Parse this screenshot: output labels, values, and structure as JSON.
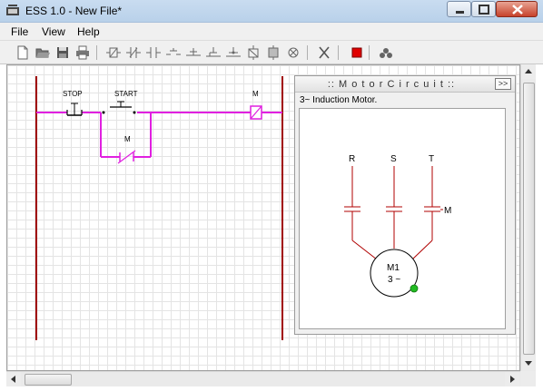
{
  "window": {
    "title": "ESS 1.0 - New File*",
    "controls": {
      "minimize": "minimize",
      "maximize": "maximize",
      "close": "close"
    }
  },
  "menu": {
    "items": [
      {
        "label": "File"
      },
      {
        "label": "View"
      },
      {
        "label": "Help"
      }
    ]
  },
  "toolbar": {
    "buttons": [
      "new-file-icon",
      "open-folder-icon",
      "save-icon",
      "print-icon",
      "coil-tool-icon",
      "contact-no-icon",
      "contact-nc-icon",
      "contact-no-alt-icon",
      "branch-tool-icon",
      "wire-tool-icon",
      "junction-tool-icon",
      "timer-tool-icon",
      "relay-tool-icon",
      "lamp-tool-icon",
      "delete-icon",
      "stop-simulation-icon",
      "motor-icon"
    ],
    "stop_color": "#e00000"
  },
  "ladder": {
    "rail_color": "#a00000",
    "wire_color": "#e020e0",
    "labels": {
      "stop": "STOP",
      "start": "START",
      "coil": "M",
      "hold_contact": "M"
    }
  },
  "motor_panel": {
    "title": ":: M o t o r   C i r c u i t ::",
    "collapse_label": ">>",
    "subtitle": "3~ Induction Motor.",
    "phases": [
      "R",
      "S",
      "T"
    ],
    "contactor_label": "M",
    "motor_name": "M1",
    "motor_type": "3 ~",
    "status_color": "#22bb22",
    "wire_color": "#b00000"
  }
}
